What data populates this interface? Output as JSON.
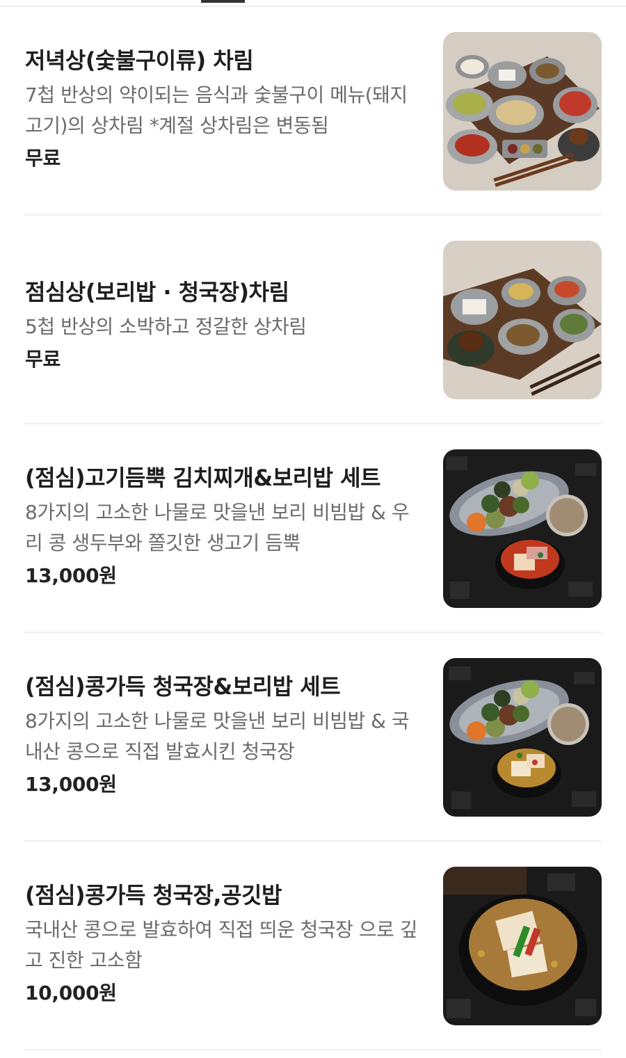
{
  "menu": {
    "items": [
      {
        "title": "저녁상(숯불구이류) 차림",
        "description": "7첩 반상의 약이되는 음식과 숯불구이 메뉴(돼지고기)의 상차림 *계절 상차림은 변동됨",
        "price": "무료",
        "image_icon": "korean-dinner-table-photo"
      },
      {
        "title": "점심상(보리밥 · 청국장)차림",
        "description": "5첩 반상의 소박하고 정갈한 상차림",
        "price": "무료",
        "image_icon": "korean-lunch-table-photo"
      },
      {
        "title": "(점심)고기듬뿍 김치찌개&보리밥 세트",
        "description": "8가지의 고소한 나물로 맛을낸 보리 비빔밥 & 우리 콩 생두부와 쫄깃한 생고기 듬뿍",
        "price": "13,000원",
        "image_icon": "kimchi-stew-set-photo"
      },
      {
        "title": "(점심)콩가득 청국장&보리밥 세트",
        "description": "8가지의 고소한 나물로 맛을낸 보리 비빔밥 & 국내산 콩으로 직접 발효시킨 청국장",
        "price": "13,000원",
        "image_icon": "cheonggukjang-set-photo"
      },
      {
        "title": "(점심)콩가득 청국장,공깃밥",
        "description": "국내산 콩으로 발효하여 직접 띄운 청국장 으로 깊고 진한 고소함",
        "price": "10,000원",
        "image_icon": "cheonggukjang-rice-photo"
      }
    ]
  },
  "colors": {
    "title": "#1e1e1e",
    "description": "#6b6b6b",
    "divider": "#efefef",
    "tab_indicator": "#333333"
  }
}
